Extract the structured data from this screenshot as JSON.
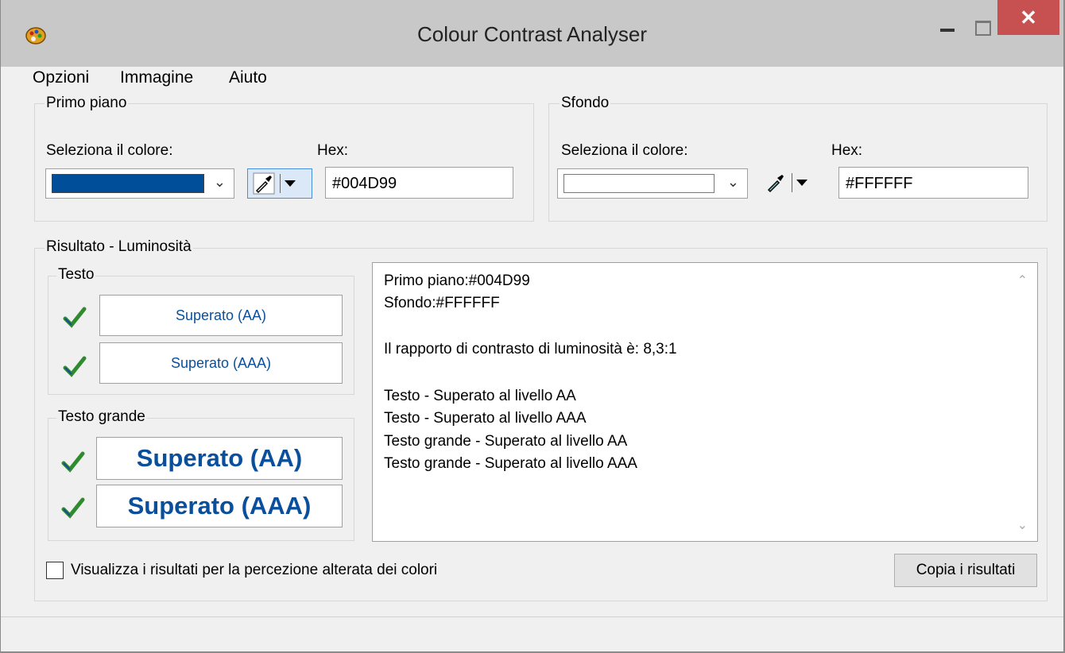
{
  "window": {
    "title": "Colour Contrast Analyser",
    "close_glyph": "✕"
  },
  "menu": [
    "Opzioni",
    "Immagine",
    "Aiuto"
  ],
  "foreground": {
    "group_label": "Primo piano",
    "select_label": "Seleziona il colore:",
    "hex_label": "Hex:",
    "hex_value": "#004D99",
    "swatch_color": "#004D99"
  },
  "background": {
    "group_label": "Sfondo",
    "select_label": "Seleziona il colore:",
    "hex_label": "Hex:",
    "hex_value": "#FFFFFF",
    "swatch_color": "#FFFFFF"
  },
  "results": {
    "group_label": "Risultato - Luminosità",
    "text_group": "Testo",
    "text_aa": "Superato (AA)",
    "text_aaa": "Superato (AAA)",
    "large_group": "Testo grande",
    "large_aa": "Superato (AA)",
    "large_aaa": "Superato (AAA)",
    "details": [
      "Primo piano:#004D99",
      "Sfondo:#FFFFFF",
      "",
      "Il rapporto di contrasto di luminosità è: 8,3:1",
      "",
      "Testo - Superato al livello AA",
      "Testo - Superato al livello AAA",
      "Testo grande - Superato al livello AA",
      "Testo grande - Superato al livello AAA"
    ]
  },
  "checkbox_label": "Visualizza i risultati per la percezione alterata dei colori",
  "copy_button": "Copia i risultati",
  "colors": {
    "pass_text": "#0A4F9C",
    "check": "#2e8b2e",
    "close_button": "#C75050"
  }
}
